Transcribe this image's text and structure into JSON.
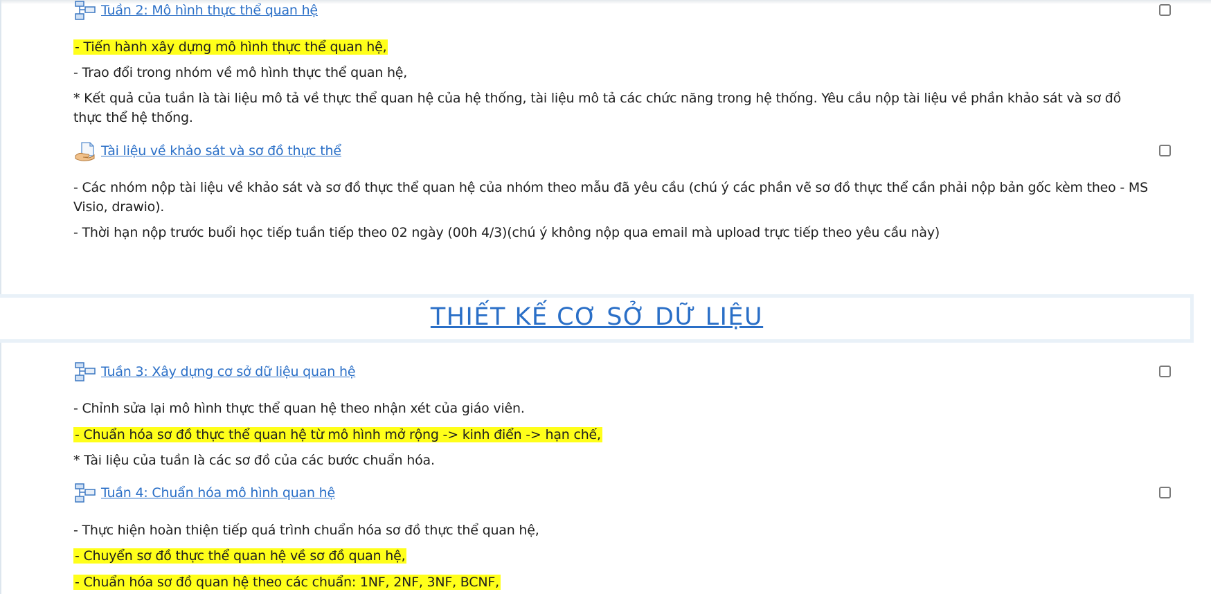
{
  "week2": {
    "link": "Tuần 2: Mô hình thực thể quan hệ",
    "lines": [
      "- Tiến hành xây dựng mô hình thực thể quan hệ,",
      "- Trao đổi trong nhóm về mô hình thực thể quan hệ,",
      "* Kết quả của tuần là tài liệu mô tả về thực thể quan hệ của hệ thống, tài liệu mô tả các chức năng trong hệ thống. Yêu cầu nộp tài liệu về phần khảo sát và sơ đồ thực thể hệ thống."
    ]
  },
  "assignment": {
    "link": "Tài liệu về khảo sát và sơ đồ thực thể",
    "lines": [
      "- Các nhóm nộp tài liệu về khảo sát và sơ đồ thực thể quan hệ của nhóm theo mẫu đã yêu cầu (chú ý các phần vẽ sơ đồ thực thể cần phải nộp bản gốc kèm theo - MS Visio, drawio).",
      "- Thời hạn nộp trước buổi học tiếp tuần tiếp theo 02 ngày (00h 4/3)(chú ý không nộp qua email mà upload trực tiếp theo yêu cầu này)"
    ]
  },
  "section_title": "THIẾT KẾ CƠ SỞ DỮ LIỆU",
  "week3": {
    "link": "Tuần 3: Xây dựng cơ sở dữ liệu quan hệ",
    "lines": [
      "- Chỉnh sửa lại mô hình thực thể quan hệ theo nhận xét của giáo viên.",
      "- Chuẩn hóa sơ đồ thực thể quan hệ từ mô hình mở rộng -> kinh điển -> hạn chế,",
      "* Tài liệu của tuần là các sơ đồ của các bước chuẩn hóa."
    ]
  },
  "week4": {
    "link": "Tuần 4: Chuẩn hóa mô hình quan hệ",
    "lines": [
      "- Thực hiện hoàn thiện tiếp quá trình chuẩn hóa sơ đồ thực thể quan hệ,",
      "- Chuyển sơ đồ thực thể quan hệ về sơ đồ quan hệ,",
      "- Chuẩn hóa sơ đồ quan hệ theo các chuẩn: 1NF, 2NF, 3NF, BCNF,"
    ]
  },
  "colors": {
    "link": "#2a6fc7",
    "highlight": "#ffff1a"
  },
  "icons": {
    "page": "page-structure-icon",
    "assign": "assignment-hand-icon"
  }
}
